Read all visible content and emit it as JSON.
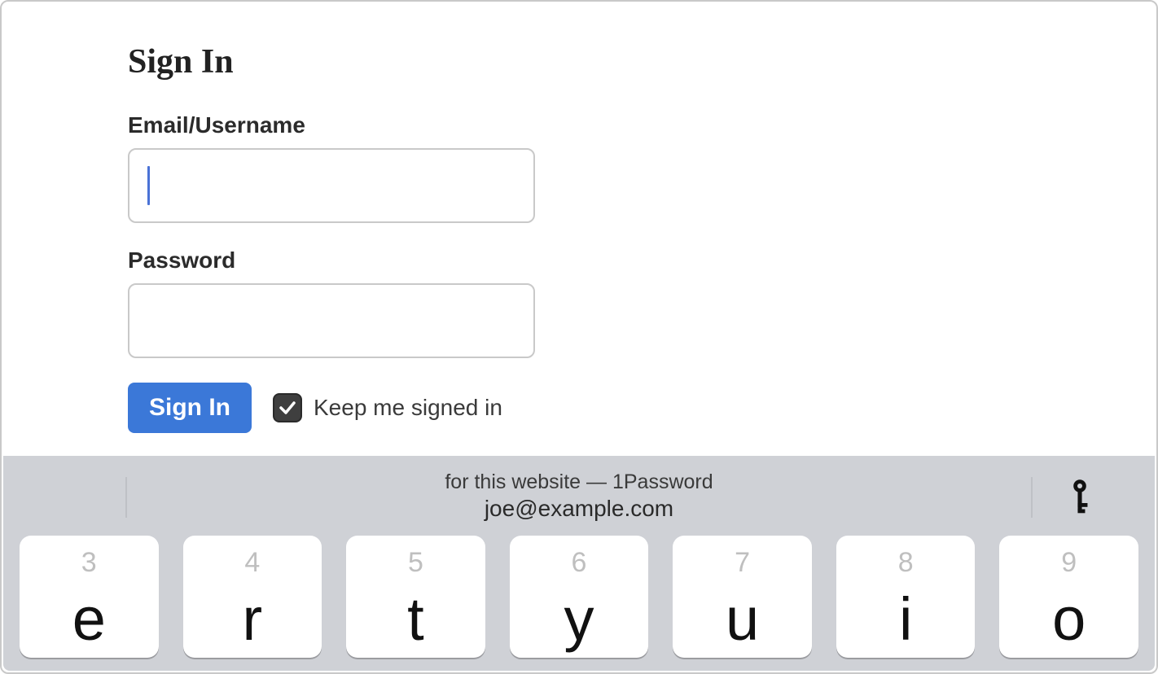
{
  "form": {
    "title": "Sign In",
    "email_label": "Email/Username",
    "email_value": "",
    "password_label": "Password",
    "password_value": "",
    "submit_label": "Sign In",
    "keep_signed_in_label": "Keep me signed in",
    "keep_signed_in_checked": true
  },
  "autofill": {
    "line1": "for this website — 1Password",
    "line2": "joe@example.com"
  },
  "keyboard": {
    "keys": [
      {
        "number": "3",
        "letter": "e"
      },
      {
        "number": "4",
        "letter": "r"
      },
      {
        "number": "5",
        "letter": "t"
      },
      {
        "number": "6",
        "letter": "y"
      },
      {
        "number": "7",
        "letter": "u"
      },
      {
        "number": "8",
        "letter": "i"
      },
      {
        "number": "9",
        "letter": "o"
      }
    ]
  }
}
